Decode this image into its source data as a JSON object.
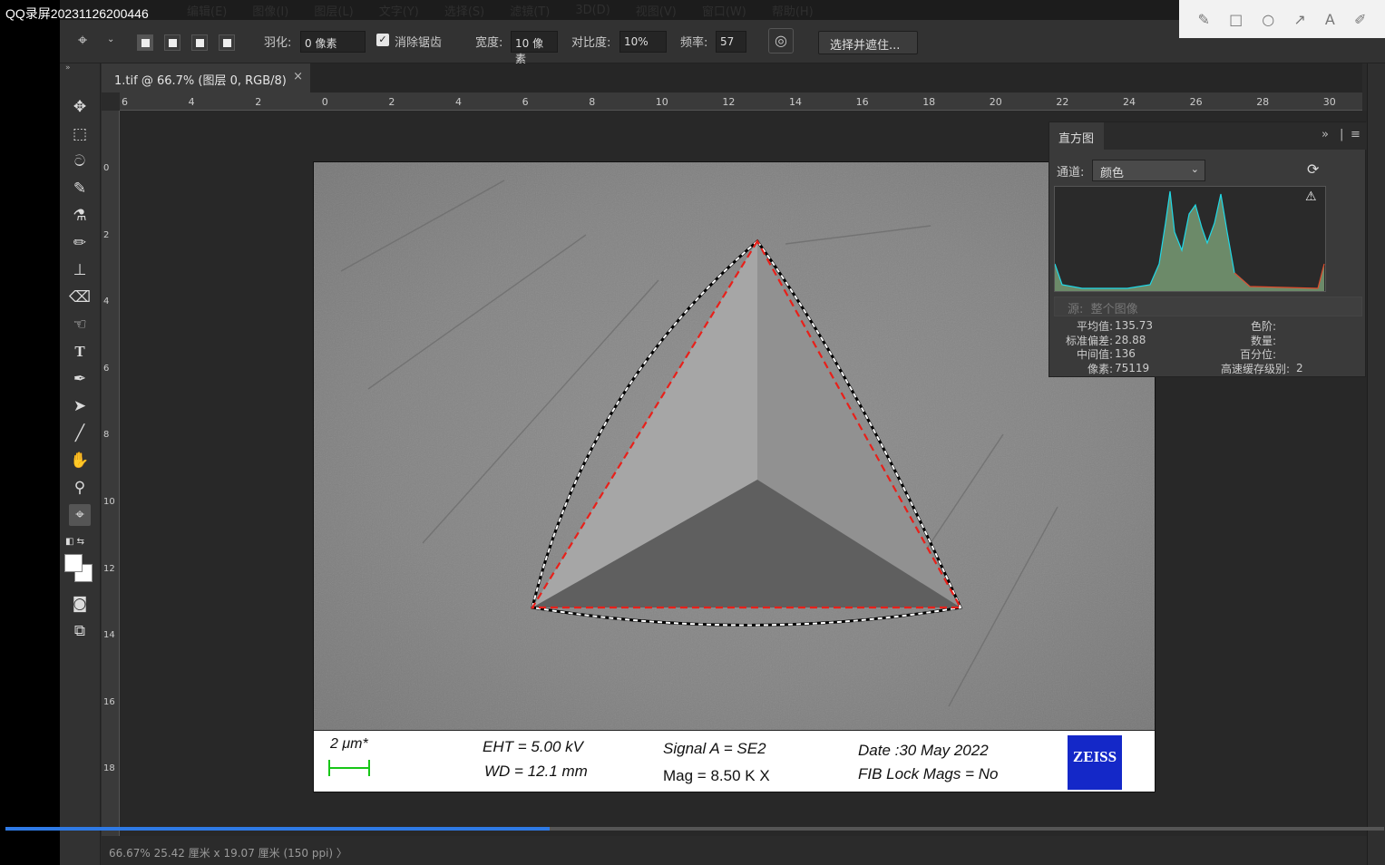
{
  "recorder": {
    "title": "QQ录屏20231126200446",
    "tools": [
      "pen-icon",
      "rectangle-icon",
      "circle-icon",
      "arrow-icon",
      "text-icon",
      "marker-icon"
    ],
    "progress": 0.395
  },
  "menu": [
    "编辑(E)",
    "图像(I)",
    "图层(L)",
    "文字(Y)",
    "选择(S)",
    "滤镜(T)",
    "3D(D)",
    "视图(V)",
    "窗口(W)",
    "帮助(H)"
  ],
  "options": {
    "feather_label": "羽化:",
    "feather_value": "0 像素",
    "antialias_label": "消除锯齿",
    "width_label": "宽度:",
    "width_value": "10 像素",
    "contrast_label": "对比度:",
    "contrast_value": "10%",
    "frequency_label": "频率:",
    "frequency_value": "57",
    "select_mask_button": "选择并遮住..."
  },
  "document": {
    "tab_label": "1.tif @ 66.7% (图层 0, RGB/8)",
    "close_glyph": "×"
  },
  "ruler_top": [
    "6",
    "4",
    "2",
    "0",
    "2",
    "4",
    "6",
    "8",
    "10",
    "12",
    "14",
    "16",
    "18",
    "20",
    "22",
    "24",
    "26",
    "28",
    "30"
  ],
  "ruler_left": [
    "0",
    "2",
    "4",
    "6",
    "8",
    "10",
    "12",
    "14",
    "16",
    "18"
  ],
  "sem_info": {
    "scale": "2 μm*",
    "eht": "EHT =  5.00 kV",
    "wd": "WD = 12.1 mm",
    "signal": "Signal A = SE2",
    "mag": "Mag =    8.50 K X",
    "date": "Date :30 May 2022",
    "fib": "FIB Lock Mags = No",
    "logo": "ZEISS"
  },
  "histogram": {
    "tab": "直方图",
    "channel_label": "通道:",
    "channel_value": "颜色",
    "source_label": "源:",
    "source_value": "整个图像",
    "stats": {
      "mean_label": "平均值:",
      "mean": "135.73",
      "std_label": "标准偏差:",
      "std": "28.88",
      "median_label": "中间值:",
      "median": "136",
      "pixels_label": "像素:",
      "pixels": "75119",
      "level_label": "色阶:",
      "count_label": "数量:",
      "percentile_label": "百分位:",
      "cache_label": "高速缓存级别:",
      "cache": "2"
    }
  },
  "status": {
    "text": "66.67%  25.42 厘米 x 19.07 厘米 (150 ppi)  〉"
  }
}
